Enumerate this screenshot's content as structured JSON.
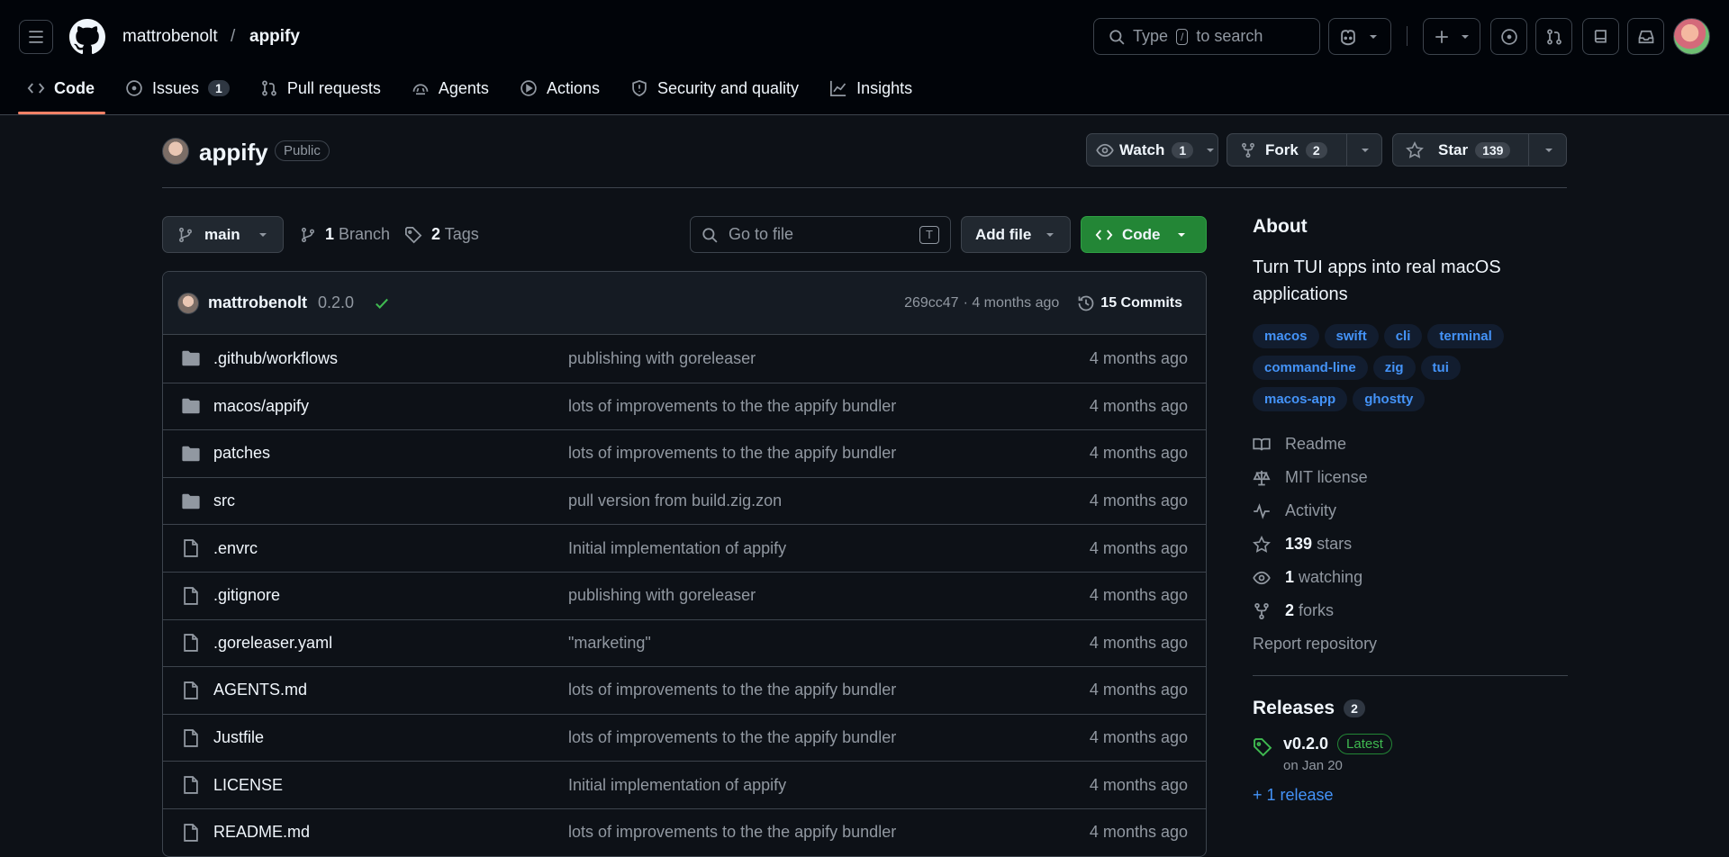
{
  "header": {
    "owner": "mattrobenolt",
    "separator": "/",
    "repo": "appify",
    "search_prefix": "Type",
    "search_key": "/",
    "search_suffix": "to search"
  },
  "tabs": [
    {
      "label": "Code",
      "icon": "code-icon"
    },
    {
      "label": "Issues",
      "icon": "issue-icon",
      "count": "1"
    },
    {
      "label": "Pull requests",
      "icon": "pull-request-icon"
    },
    {
      "label": "Agents",
      "icon": "agents-icon"
    },
    {
      "label": "Actions",
      "icon": "actions-icon"
    },
    {
      "label": "Security and quality",
      "icon": "shield-icon"
    },
    {
      "label": "Insights",
      "icon": "graph-icon"
    }
  ],
  "repo_header": {
    "name": "appify",
    "visibility": "Public",
    "watch_label": "Watch",
    "watch_count": "1",
    "fork_label": "Fork",
    "fork_count": "2",
    "star_label": "Star",
    "star_count": "139"
  },
  "toolbar": {
    "branch": "main",
    "branch_count": "1",
    "branch_label": "Branch",
    "tag_count": "2",
    "tag_label": "Tags",
    "goto_placeholder": "Go to file",
    "goto_key": "T",
    "add_file": "Add file",
    "code": "Code"
  },
  "commit": {
    "author": "mattrobenolt",
    "message": "0.2.0",
    "hash": "269cc47",
    "time": "· 4 months ago",
    "commits": "15 Commits"
  },
  "files": [
    {
      "type": "dir",
      "name": ".github/workflows",
      "message": "publishing with goreleaser",
      "date": "4 months ago"
    },
    {
      "type": "dir",
      "name": "macos/appify",
      "message": "lots of improvements to the the appify bundler",
      "date": "4 months ago"
    },
    {
      "type": "dir",
      "name": "patches",
      "message": "lots of improvements to the the appify bundler",
      "date": "4 months ago"
    },
    {
      "type": "dir",
      "name": "src",
      "message": "pull version from build.zig.zon",
      "date": "4 months ago"
    },
    {
      "type": "file",
      "name": ".envrc",
      "message": "Initial implementation of appify",
      "date": "4 months ago"
    },
    {
      "type": "file",
      "name": ".gitignore",
      "message": "publishing with goreleaser",
      "date": "4 months ago"
    },
    {
      "type": "file",
      "name": ".goreleaser.yaml",
      "message": "\"marketing\"",
      "date": "4 months ago"
    },
    {
      "type": "file",
      "name": "AGENTS.md",
      "message": "lots of improvements to the the appify bundler",
      "date": "4 months ago"
    },
    {
      "type": "file",
      "name": "Justfile",
      "message": "lots of improvements to the the appify bundler",
      "date": "4 months ago"
    },
    {
      "type": "file",
      "name": "LICENSE",
      "message": "Initial implementation of appify",
      "date": "4 months ago"
    },
    {
      "type": "file",
      "name": "README.md",
      "message": "lots of improvements to the the appify bundler",
      "date": "4 months ago"
    }
  ],
  "about": {
    "title": "About",
    "description": "Turn TUI apps into real macOS applications",
    "topics": [
      "macos",
      "swift",
      "cli",
      "terminal",
      "command-line",
      "zig",
      "tui",
      "macos-app",
      "ghostty"
    ],
    "readme": "Readme",
    "license": "MIT license",
    "activity": "Activity",
    "stars_count": "139",
    "stars_label": "stars",
    "watching_count": "1",
    "watching_label": "watching",
    "forks_count": "2",
    "forks_label": "forks",
    "report": "Report repository"
  },
  "releases": {
    "title": "Releases",
    "count": "2",
    "latest_tag": "v0.2.0",
    "latest_badge": "Latest",
    "latest_date": "on Jan 20",
    "more": "+ 1 release"
  },
  "colors": {
    "background": "#0d1117",
    "header_bg": "#010409",
    "accent_green": "#238636",
    "link_blue": "#4493f8",
    "tab_underline": "#f78166"
  }
}
